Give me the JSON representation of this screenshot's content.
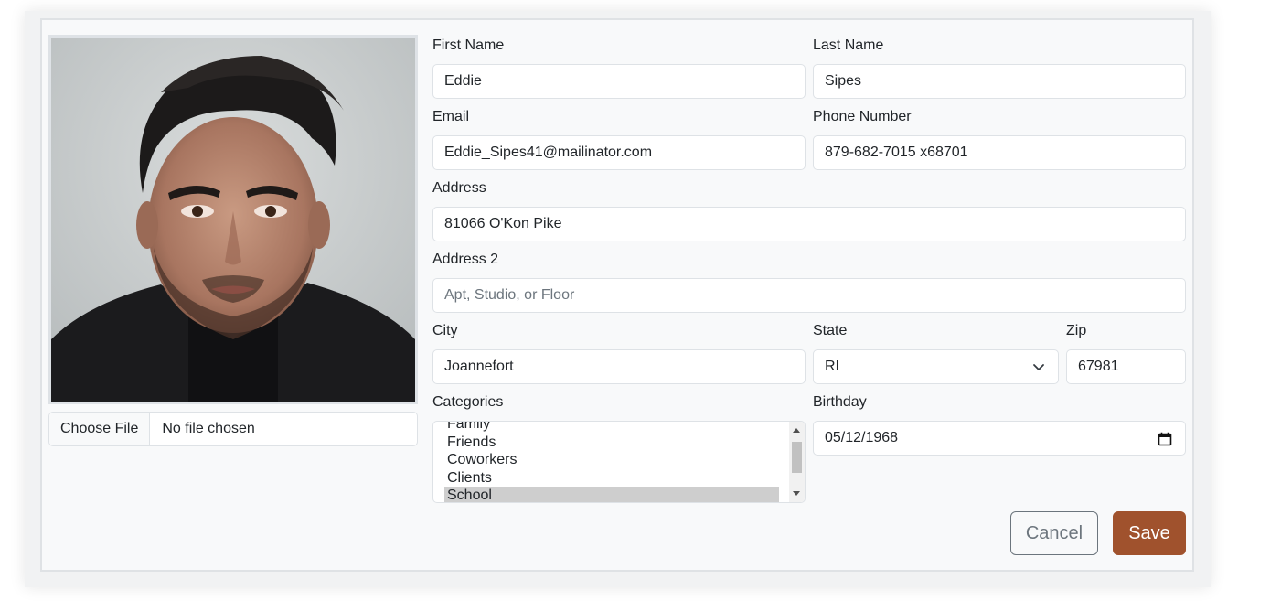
{
  "file_input": {
    "button_label": "Choose File",
    "status": "No file chosen"
  },
  "form": {
    "first_name": {
      "label": "First Name",
      "value": "Eddie"
    },
    "last_name": {
      "label": "Last Name",
      "value": "Sipes"
    },
    "email": {
      "label": "Email",
      "value": "Eddie_Sipes41@mailinator.com"
    },
    "phone": {
      "label": "Phone Number",
      "value": "879-682-7015 x68701"
    },
    "address": {
      "label": "Address",
      "value": "81066 O'Kon Pike"
    },
    "address2": {
      "label": "Address 2",
      "placeholder": "Apt, Studio, or Floor",
      "value": ""
    },
    "city": {
      "label": "City",
      "value": "Joannefort"
    },
    "state": {
      "label": "State",
      "value": "RI"
    },
    "zip": {
      "label": "Zip",
      "value": "67981"
    },
    "categories": {
      "label": "Categories",
      "options": [
        "Family",
        "Friends",
        "Coworkers",
        "Clients",
        "School"
      ],
      "selected": "School"
    },
    "birthday": {
      "label": "Birthday",
      "value": "05/12/1968"
    }
  },
  "actions": {
    "cancel_label": "Cancel",
    "save_label": "Save"
  },
  "colors": {
    "save_button": "#a0522d",
    "card_background": "#f8f9fa",
    "input_border": "#dee2e6"
  },
  "icons": {
    "state_select": "chevron-down-icon",
    "birthday": "calendar-icon"
  }
}
